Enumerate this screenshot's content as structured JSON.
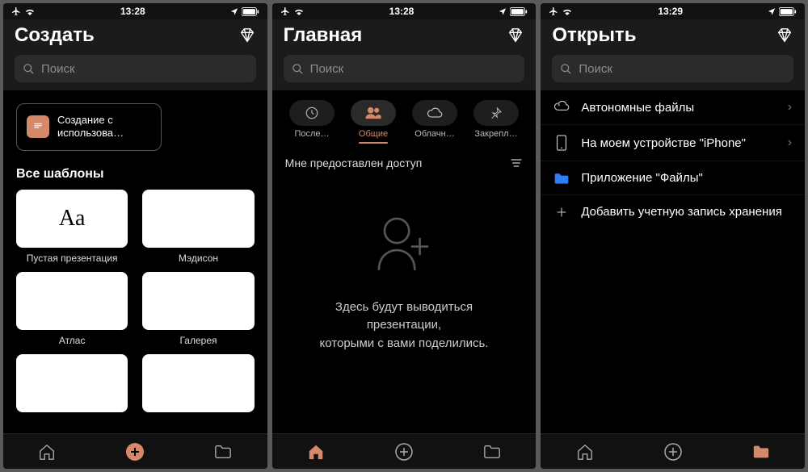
{
  "accent": "#d48a6a",
  "statusbar": {
    "time1": "13:28",
    "time2": "13:28",
    "time3": "13:29"
  },
  "common": {
    "search_placeholder": "Поиск"
  },
  "screen1": {
    "title": "Создать",
    "promo_line1": "Создание с",
    "promo_line2": "использова…",
    "section_title": "Все шаблоны",
    "templates": [
      {
        "label": "Пустая презентация",
        "preview": "Aa"
      },
      {
        "label": "Мэдисон",
        "preview": ""
      },
      {
        "label": "Атлас",
        "preview": ""
      },
      {
        "label": "Галерея",
        "preview": ""
      },
      {
        "label": "",
        "preview": ""
      },
      {
        "label": "",
        "preview": ""
      }
    ],
    "tabbar_active": "create"
  },
  "screen2": {
    "title": "Главная",
    "filters": [
      {
        "id": "recent",
        "label": "После…",
        "icon": "clock"
      },
      {
        "id": "shared",
        "label": "Общие",
        "icon": "people",
        "active": true
      },
      {
        "id": "cloud",
        "label": "Облачн…",
        "icon": "cloud"
      },
      {
        "id": "pinned",
        "label": "Закрепл…",
        "icon": "pin"
      }
    ],
    "shared_header": "Мне предоставлен доступ",
    "empty_line1": "Здесь будут выводиться презентации,",
    "empty_line2": "которыми с вами поделились.",
    "tabbar_active": "home"
  },
  "screen3": {
    "title": "Открыть",
    "locations": [
      {
        "id": "offline",
        "label": "Автономные файлы",
        "icon": "cloud-offline",
        "chevron": true
      },
      {
        "id": "device",
        "label": "На моем устройстве \"iPhone\"",
        "icon": "phone",
        "chevron": true
      },
      {
        "id": "files",
        "label": "Приложение \"Файлы\"",
        "icon": "folder-blue",
        "chevron": false
      },
      {
        "id": "add",
        "label": "Добавить учетную запись хранения",
        "icon": "plus",
        "chevron": false
      }
    ],
    "tabbar_active": "open"
  }
}
